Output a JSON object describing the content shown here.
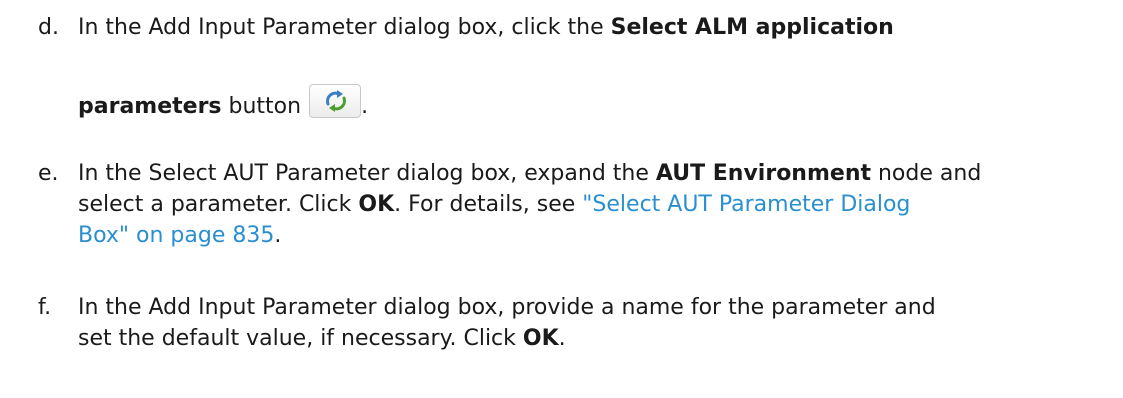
{
  "steps": [
    {
      "marker": "d.",
      "line1": {
        "pre": "In the Add Input Parameter dialog box, click the ",
        "bold": "Select ALM application"
      },
      "line2": {
        "bold": "parameters",
        "post_button": " button",
        "after": "."
      },
      "button_icon": "refresh-parameters-icon"
    },
    {
      "marker": "e.",
      "line1": {
        "pre": "In the Select AUT Parameter dialog box, expand the ",
        "bold": "AUT Environment",
        "post": " node and"
      },
      "line2": {
        "pre": "select a parameter. Click ",
        "bold": "OK",
        "mid": ". For details, see ",
        "link": "\"Select AUT Parameter Dialog"
      },
      "line3": {
        "link": "Box\" on page 835",
        "post": "."
      }
    },
    {
      "marker": "f.",
      "line1": {
        "text": "In the Add Input Parameter dialog box, provide a name for the parameter and"
      },
      "line2": {
        "pre": "set the default value, if necessary. Click ",
        "bold": "OK",
        "post": "."
      }
    }
  ],
  "colors": {
    "text": "#1a1a1a",
    "link": "#2a8fd0",
    "icon_blue": "#3b7fc4",
    "icon_green": "#4aa02c"
  }
}
